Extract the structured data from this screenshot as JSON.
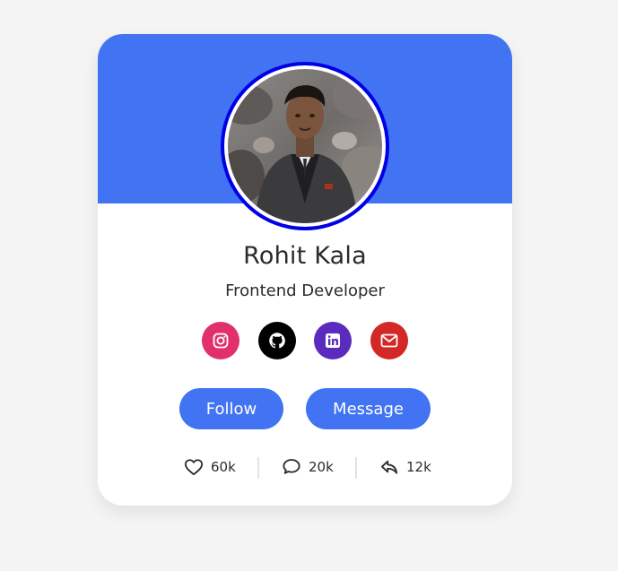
{
  "colors": {
    "accent": "#4173f2",
    "avatar_ring": "#0000e6",
    "instagram": "#e1306c",
    "github": "#000000",
    "linkedin": "#5b2bbd",
    "mail": "#d42828"
  },
  "profile": {
    "name": "Rohit Kala",
    "role": "Frontend Developer"
  },
  "socials": [
    {
      "icon": "instagram-icon"
    },
    {
      "icon": "github-icon"
    },
    {
      "icon": "linkedin-icon"
    },
    {
      "icon": "mail-icon"
    }
  ],
  "actions": {
    "follow_label": "Follow",
    "message_label": "Message"
  },
  "stats": {
    "likes": "60k",
    "comments": "20k",
    "shares": "12k"
  }
}
